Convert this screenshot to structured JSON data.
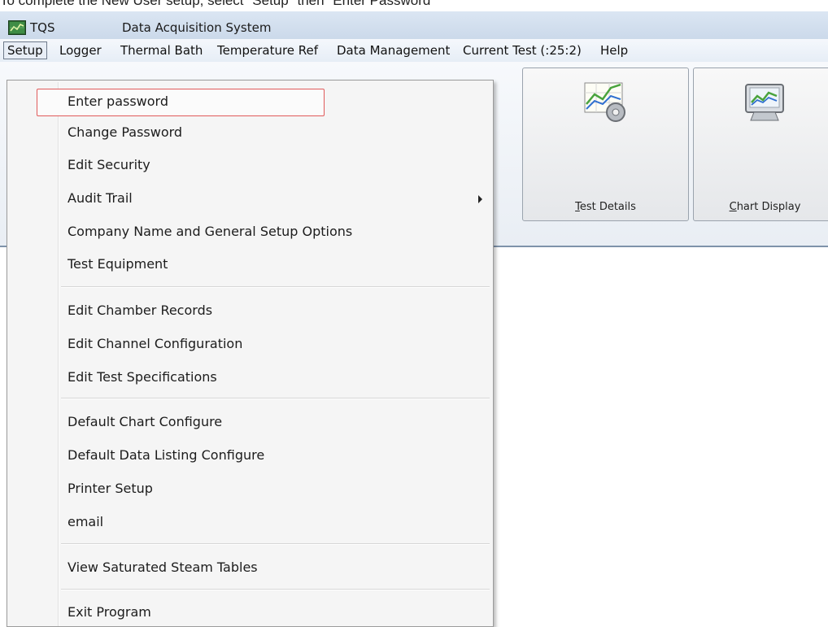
{
  "instruction": "To complete the New User setup, select \"Setup\" then \"Enter Password\"",
  "title": {
    "app_name": "TQS",
    "app_title": "Data Acquisition System",
    "icon": "chart-app-icon"
  },
  "menubar": [
    {
      "label": "Setup",
      "active": true
    },
    {
      "label": "Logger"
    },
    {
      "label": "Thermal Bath"
    },
    {
      "label": "Temperature Ref"
    },
    {
      "label": "Data Management"
    },
    {
      "label": "Current Test (:25:2)"
    },
    {
      "label": "Help"
    }
  ],
  "toolbar": {
    "test_details": {
      "mnemonic": "T",
      "rest": "est Details",
      "icon": "chart-gear-icon"
    },
    "chart_display": {
      "mnemonic": "C",
      "rest": "hart Display",
      "icon": "monitor-chart-icon"
    }
  },
  "setup_menu": {
    "groups": [
      [
        {
          "label": "Enter password",
          "highlighted": true
        },
        {
          "label": "Change Password"
        },
        {
          "label": "Edit Security"
        },
        {
          "label": "Audit Trail",
          "has_submenu": true
        },
        {
          "label": "Company Name and General Setup Options"
        },
        {
          "label": "Test Equipment"
        }
      ],
      [
        {
          "label": "Edit Chamber Records"
        },
        {
          "label": "Edit Channel Configuration"
        },
        {
          "label": "Edit Test Specifications"
        }
      ],
      [
        {
          "label": "Default Chart Configure"
        },
        {
          "label": "Default Data Listing Configure"
        },
        {
          "label": "Printer Setup"
        },
        {
          "label": "email"
        }
      ],
      [
        {
          "label": "View Saturated Steam Tables"
        }
      ],
      [
        {
          "label": "Exit Program"
        }
      ]
    ]
  },
  "colors": {
    "highlight_border": "#e05a5a",
    "titlebar": "#cbd9ea"
  }
}
